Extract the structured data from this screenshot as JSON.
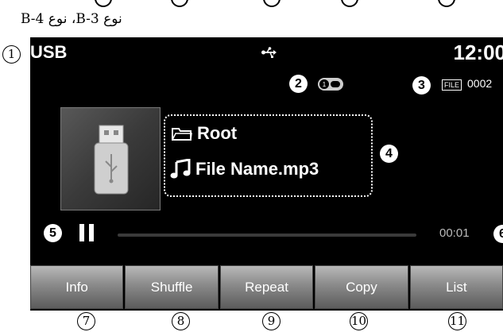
{
  "caption": "نوع B-3، نوع B-4",
  "status_bar": {
    "source": "USB",
    "source_icon": "usb-icon",
    "clock": "12:00"
  },
  "media": {
    "disc_icon": "disc-indicator-icon",
    "file_badge": "FILE",
    "file_count": "0002",
    "folder": "Root",
    "file_name": "File Name.mp3",
    "elapsed": "00:01",
    "progress": 0
  },
  "buttons": [
    "Info",
    "Shuffle",
    "Repeat",
    "Copy",
    "List"
  ],
  "callouts": {
    "c1": "1",
    "c2": "2",
    "c3": "3",
    "c4": "4",
    "c5": "5",
    "c6": "6",
    "c7": "7",
    "c8": "8",
    "c9": "9",
    "c10": "10",
    "c11": "11"
  },
  "colors": {
    "screen": "#000000",
    "button": "#8a8a8a",
    "text": "#ffffff"
  }
}
